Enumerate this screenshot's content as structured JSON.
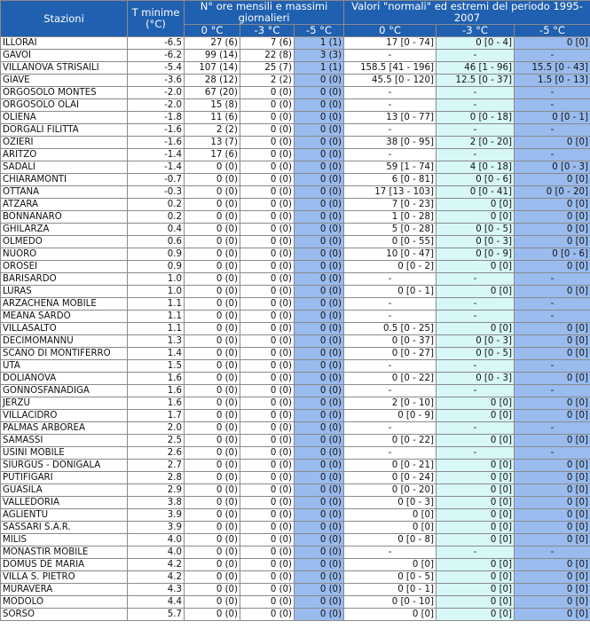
{
  "header": {
    "stazioni": "Stazioni",
    "tmin": "T minime (°C)",
    "ore_group": "N° ore mensili e massimi giornalieri",
    "normali_group": "Valori \"normali\" ed estremi del periodo 1995-2007",
    "sub_0": "0 °C",
    "sub_m3": "-3 °C",
    "sub_m5": "-5 °C"
  },
  "colors": {
    "header_bg": "#2060b0",
    "col_minus5_bg": "#99bbee",
    "col_minus3_normali_bg": "#d8f7f7"
  },
  "rows": [
    {
      "name": "ILLORAI",
      "tmin": "-6.5",
      "h0": "27 (6)",
      "h3": "7 (6)",
      "h5": "1 (1)",
      "n0": "17 [0 - 74]",
      "n3": "0 [0 - 4]",
      "n5": "0 [0]"
    },
    {
      "name": "GAVOI",
      "tmin": "-6.2",
      "h0": "99 (14)",
      "h3": "22 (8)",
      "h5": "3 (3)",
      "n0": "-",
      "n3": "-",
      "n5": "-"
    },
    {
      "name": "VILLANOVA STRISAILI",
      "tmin": "-5.4",
      "h0": "107 (14)",
      "h3": "25 (7)",
      "h5": "1 (1)",
      "n0": "158.5 [41 - 196]",
      "n3": "46 [1 - 96]",
      "n5": "15.5 [0 - 43]"
    },
    {
      "name": "GIAVE",
      "tmin": "-3.6",
      "h0": "28 (12)",
      "h3": "2 (2)",
      "h5": "0 (0)",
      "n0": "45.5 [0 - 120]",
      "n3": "12.5 [0 - 37]",
      "n5": "1.5 [0 - 13]"
    },
    {
      "name": "ORGOSOLO MONTES",
      "tmin": "-2.0",
      "h0": "67 (20)",
      "h3": "0 (0)",
      "h5": "0 (0)",
      "n0": "-",
      "n3": "-",
      "n5": "-"
    },
    {
      "name": "ORGOSOLO OLAI",
      "tmin": "-2.0",
      "h0": "15 (8)",
      "h3": "0 (0)",
      "h5": "0 (0)",
      "n0": "-",
      "n3": "-",
      "n5": "-"
    },
    {
      "name": "OLIENA",
      "tmin": "-1.8",
      "h0": "11 (6)",
      "h3": "0 (0)",
      "h5": "0 (0)",
      "n0": "13 [0 - 77]",
      "n3": "0 [0 - 18]",
      "n5": "0 [0 - 1]"
    },
    {
      "name": "DORGALI FILITTA",
      "tmin": "-1.6",
      "h0": "2 (2)",
      "h3": "0 (0)",
      "h5": "0 (0)",
      "n0": "-",
      "n3": "-",
      "n5": "-"
    },
    {
      "name": "OZIERI",
      "tmin": "-1.6",
      "h0": "13 (7)",
      "h3": "0 (0)",
      "h5": "0 (0)",
      "n0": "38 [0 - 95]",
      "n3": "2 [0 - 20]",
      "n5": "0 [0]"
    },
    {
      "name": "ARITZO",
      "tmin": "-1.4",
      "h0": "17 (6)",
      "h3": "0 (0)",
      "h5": "0 (0)",
      "n0": "-",
      "n3": "-",
      "n5": "-"
    },
    {
      "name": "SADALI",
      "tmin": "-1.4",
      "h0": "0 (0)",
      "h3": "0 (0)",
      "h5": "0 (0)",
      "n0": "59 [1 - 74]",
      "n3": "4 [0 - 18]",
      "n5": "0 [0 - 3]"
    },
    {
      "name": "CHIARAMONTI",
      "tmin": "-0.7",
      "h0": "0 (0)",
      "h3": "0 (0)",
      "h5": "0 (0)",
      "n0": "6 [0 - 81]",
      "n3": "0 [0 - 6]",
      "n5": "0 [0]"
    },
    {
      "name": "OTTANA",
      "tmin": "-0.3",
      "h0": "0 (0)",
      "h3": "0 (0)",
      "h5": "0 (0)",
      "n0": "17 [13 - 103]",
      "n3": "0 [0 - 41]",
      "n5": "0 [0 - 20]"
    },
    {
      "name": "ATZARA",
      "tmin": "0.2",
      "h0": "0 (0)",
      "h3": "0 (0)",
      "h5": "0 (0)",
      "n0": "7 [0 - 23]",
      "n3": "0 [0]",
      "n5": "0 [0]"
    },
    {
      "name": "BONNANARO",
      "tmin": "0.2",
      "h0": "0 (0)",
      "h3": "0 (0)",
      "h5": "0 (0)",
      "n0": "1 [0 - 28]",
      "n3": "0 [0]",
      "n5": "0 [0]"
    },
    {
      "name": "GHILARZA",
      "tmin": "0.4",
      "h0": "0 (0)",
      "h3": "0 (0)",
      "h5": "0 (0)",
      "n0": "5 [0 - 28]",
      "n3": "0 [0 - 5]",
      "n5": "0 [0]"
    },
    {
      "name": "OLMEDO",
      "tmin": "0.6",
      "h0": "0 (0)",
      "h3": "0 (0)",
      "h5": "0 (0)",
      "n0": "0 [0 - 55]",
      "n3": "0 [0 - 3]",
      "n5": "0 [0]"
    },
    {
      "name": "NUORO",
      "tmin": "0.9",
      "h0": "0 (0)",
      "h3": "0 (0)",
      "h5": "0 (0)",
      "n0": "10 [0 - 47]",
      "n3": "0 [0 - 9]",
      "n5": "0 [0 - 6]"
    },
    {
      "name": "OROSEI",
      "tmin": "0.9",
      "h0": "0 (0)",
      "h3": "0 (0)",
      "h5": "0 (0)",
      "n0": "0 [0 - 2]",
      "n3": "0 [0]",
      "n5": "0 [0]"
    },
    {
      "name": "BARISARDO",
      "tmin": "1.0",
      "h0": "0 (0)",
      "h3": "0 (0)",
      "h5": "0 (0)",
      "n0": "-",
      "n3": "-",
      "n5": "-"
    },
    {
      "name": "LURAS",
      "tmin": "1.0",
      "h0": "0 (0)",
      "h3": "0 (0)",
      "h5": "0 (0)",
      "n0": "0 [0 - 1]",
      "n3": "0 [0]",
      "n5": "0 [0]"
    },
    {
      "name": "ARZACHENA MOBILE",
      "tmin": "1.1",
      "h0": "0 (0)",
      "h3": "0 (0)",
      "h5": "0 (0)",
      "n0": "-",
      "n3": "-",
      "n5": "-"
    },
    {
      "name": "MEANA SARDO",
      "tmin": "1.1",
      "h0": "0 (0)",
      "h3": "0 (0)",
      "h5": "0 (0)",
      "n0": "-",
      "n3": "-",
      "n5": "-"
    },
    {
      "name": "VILLASALTO",
      "tmin": "1.1",
      "h0": "0 (0)",
      "h3": "0 (0)",
      "h5": "0 (0)",
      "n0": "0.5 [0 - 25]",
      "n3": "0 [0]",
      "n5": "0 [0]"
    },
    {
      "name": "DECIMOMANNU",
      "tmin": "1.3",
      "h0": "0 (0)",
      "h3": "0 (0)",
      "h5": "0 (0)",
      "n0": "0 [0 - 37]",
      "n3": "0 [0 - 3]",
      "n5": "0 [0]"
    },
    {
      "name": "SCANO DI MONTIFERRO",
      "tmin": "1.4",
      "h0": "0 (0)",
      "h3": "0 (0)",
      "h5": "0 (0)",
      "n0": "0 [0 - 27]",
      "n3": "0 [0 - 5]",
      "n5": "0 [0]"
    },
    {
      "name": "UTA",
      "tmin": "1.5",
      "h0": "0 (0)",
      "h3": "0 (0)",
      "h5": "0 (0)",
      "n0": "-",
      "n3": "-",
      "n5": "-"
    },
    {
      "name": "DOLIANOVA",
      "tmin": "1.6",
      "h0": "0 (0)",
      "h3": "0 (0)",
      "h5": "0 (0)",
      "n0": "0 [0 - 22]",
      "n3": "0 [0 - 3]",
      "n5": "0 [0]"
    },
    {
      "name": "GONNOSFANADIGA",
      "tmin": "1.6",
      "h0": "0 (0)",
      "h3": "0 (0)",
      "h5": "0 (0)",
      "n0": "-",
      "n3": "-",
      "n5": "-"
    },
    {
      "name": "JERZU",
      "tmin": "1.6",
      "h0": "0 (0)",
      "h3": "0 (0)",
      "h5": "0 (0)",
      "n0": "2 [0 - 10]",
      "n3": "0 [0]",
      "n5": "0 [0]"
    },
    {
      "name": "VILLACIDRO",
      "tmin": "1.7",
      "h0": "0 (0)",
      "h3": "0 (0)",
      "h5": "0 (0)",
      "n0": "0 [0 - 9]",
      "n3": "0 [0]",
      "n5": "0 [0]"
    },
    {
      "name": "PALMAS ARBOREA",
      "tmin": "2.0",
      "h0": "0 (0)",
      "h3": "0 (0)",
      "h5": "0 (0)",
      "n0": "-",
      "n3": "-",
      "n5": "-"
    },
    {
      "name": "SAMASSI",
      "tmin": "2.5",
      "h0": "0 (0)",
      "h3": "0 (0)",
      "h5": "0 (0)",
      "n0": "0 [0 - 22]",
      "n3": "0 [0]",
      "n5": "0 [0]"
    },
    {
      "name": "USINI MOBILE",
      "tmin": "2.6",
      "h0": "0 (0)",
      "h3": "0 (0)",
      "h5": "0 (0)",
      "n0": "-",
      "n3": "-",
      "n5": "-"
    },
    {
      "name": "SIURGUS - DONIGALA",
      "tmin": "2.7",
      "h0": "0 (0)",
      "h3": "0 (0)",
      "h5": "0 (0)",
      "n0": "0 [0 - 21]",
      "n3": "0 [0]",
      "n5": "0 [0]"
    },
    {
      "name": "PUTIFIGARI",
      "tmin": "2.8",
      "h0": "0 (0)",
      "h3": "0 (0)",
      "h5": "0 (0)",
      "n0": "0 [0 - 24]",
      "n3": "0 [0]",
      "n5": "0 [0]"
    },
    {
      "name": "GUASILA",
      "tmin": "2.9",
      "h0": "0 (0)",
      "h3": "0 (0)",
      "h5": "0 (0)",
      "n0": "0 [0 - 20]",
      "n3": "0 [0]",
      "n5": "0 [0]"
    },
    {
      "name": "VALLEDORIA",
      "tmin": "3.8",
      "h0": "0 (0)",
      "h3": "0 (0)",
      "h5": "0 (0)",
      "n0": "0 [0 - 3]",
      "n3": "0 [0]",
      "n5": "0 [0]"
    },
    {
      "name": "AGLIENTU",
      "tmin": "3.9",
      "h0": "0 (0)",
      "h3": "0 (0)",
      "h5": "0 (0)",
      "n0": "0 [0]",
      "n3": "0 [0]",
      "n5": "0 [0]"
    },
    {
      "name": "SASSARI S.A.R.",
      "tmin": "3.9",
      "h0": "0 (0)",
      "h3": "0 (0)",
      "h5": "0 (0)",
      "n0": "0 [0]",
      "n3": "0 [0]",
      "n5": "0 [0]"
    },
    {
      "name": "MILIS",
      "tmin": "4.0",
      "h0": "0 (0)",
      "h3": "0 (0)",
      "h5": "0 (0)",
      "n0": "0 [0 - 8]",
      "n3": "0 [0]",
      "n5": "0 [0]"
    },
    {
      "name": "MONASTIR MOBILE",
      "tmin": "4.0",
      "h0": "0 (0)",
      "h3": "0 (0)",
      "h5": "0 (0)",
      "n0": "-",
      "n3": "-",
      "n5": "-"
    },
    {
      "name": "DOMUS DE MARIA",
      "tmin": "4.2",
      "h0": "0 (0)",
      "h3": "0 (0)",
      "h5": "0 (0)",
      "n0": "0 [0]",
      "n3": "0 [0]",
      "n5": "0 [0]"
    },
    {
      "name": "VILLA S. PIETRO",
      "tmin": "4.2",
      "h0": "0 (0)",
      "h3": "0 (0)",
      "h5": "0 (0)",
      "n0": "0 [0 - 5]",
      "n3": "0 [0]",
      "n5": "0 [0]"
    },
    {
      "name": "MURAVERA",
      "tmin": "4.3",
      "h0": "0 (0)",
      "h3": "0 (0)",
      "h5": "0 (0)",
      "n0": "0 [0 - 1]",
      "n3": "0 [0]",
      "n5": "0 [0]"
    },
    {
      "name": "MODOLO",
      "tmin": "4.4",
      "h0": "0 (0)",
      "h3": "0 (0)",
      "h5": "0 (0)",
      "n0": "0 [0 - 10]",
      "n3": "0 [0]",
      "n5": "0 [0]"
    },
    {
      "name": "SORSO",
      "tmin": "5.7",
      "h0": "0 (0)",
      "h3": "0 (0)",
      "h5": "0 (0)",
      "n0": "0 [0]",
      "n3": "0 [0]",
      "n5": "0 [0]"
    }
  ]
}
